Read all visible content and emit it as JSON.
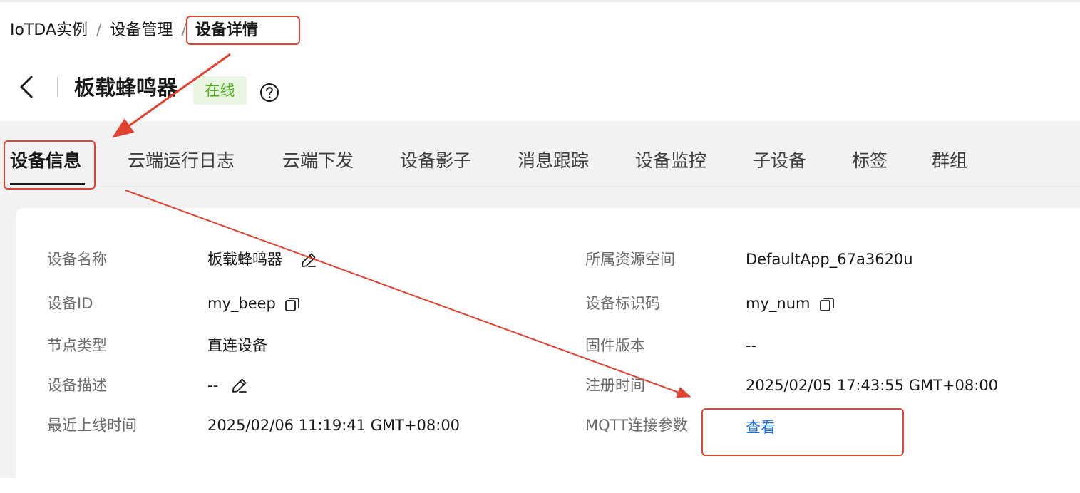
{
  "breadcrumb": {
    "items": [
      {
        "label": "IoTDA实例"
      },
      {
        "label": "设备管理"
      },
      {
        "label": "设备详情"
      }
    ],
    "separator": "/"
  },
  "header": {
    "title": "板载蜂鸣器",
    "status": "在线",
    "status_color": "#50b01e",
    "back_icon": "chevron-left-icon",
    "help_icon": "question-circle-icon"
  },
  "tabs": [
    {
      "label": "设备信息",
      "active": true
    },
    {
      "label": "云端运行日志"
    },
    {
      "label": "云端下发"
    },
    {
      "label": "设备影子"
    },
    {
      "label": "消息跟踪"
    },
    {
      "label": "设备监控"
    },
    {
      "label": "子设备"
    },
    {
      "label": "标签"
    },
    {
      "label": "群组"
    }
  ],
  "device_info": {
    "left": [
      {
        "label": "设备名称",
        "value": "板载蜂鸣器",
        "icon": "edit-icon"
      },
      {
        "label": "设备ID",
        "value": "my_beep",
        "icon": "copy-icon"
      },
      {
        "label": "节点类型",
        "value": "直连设备"
      },
      {
        "label": "设备描述",
        "value": "--",
        "icon": "edit-icon"
      },
      {
        "label": "最近上线时间",
        "value": "2025/02/06 11:19:41 GMT+08:00"
      }
    ],
    "right": [
      {
        "label": "所属资源空间",
        "value": "DefaultApp_67a3620u"
      },
      {
        "label": "设备标识码",
        "value": "my_num",
        "icon": "copy-icon"
      },
      {
        "label": "固件版本",
        "value": "--"
      },
      {
        "label": "注册时间",
        "value": "2025/02/05 17:43:55 GMT+08:00"
      },
      {
        "label": "MQTT连接参数",
        "value": "查看"
      }
    ]
  },
  "colors": {
    "annotation": "#e04330",
    "link": "#1a6fe0",
    "background": "#f2f2f2"
  }
}
